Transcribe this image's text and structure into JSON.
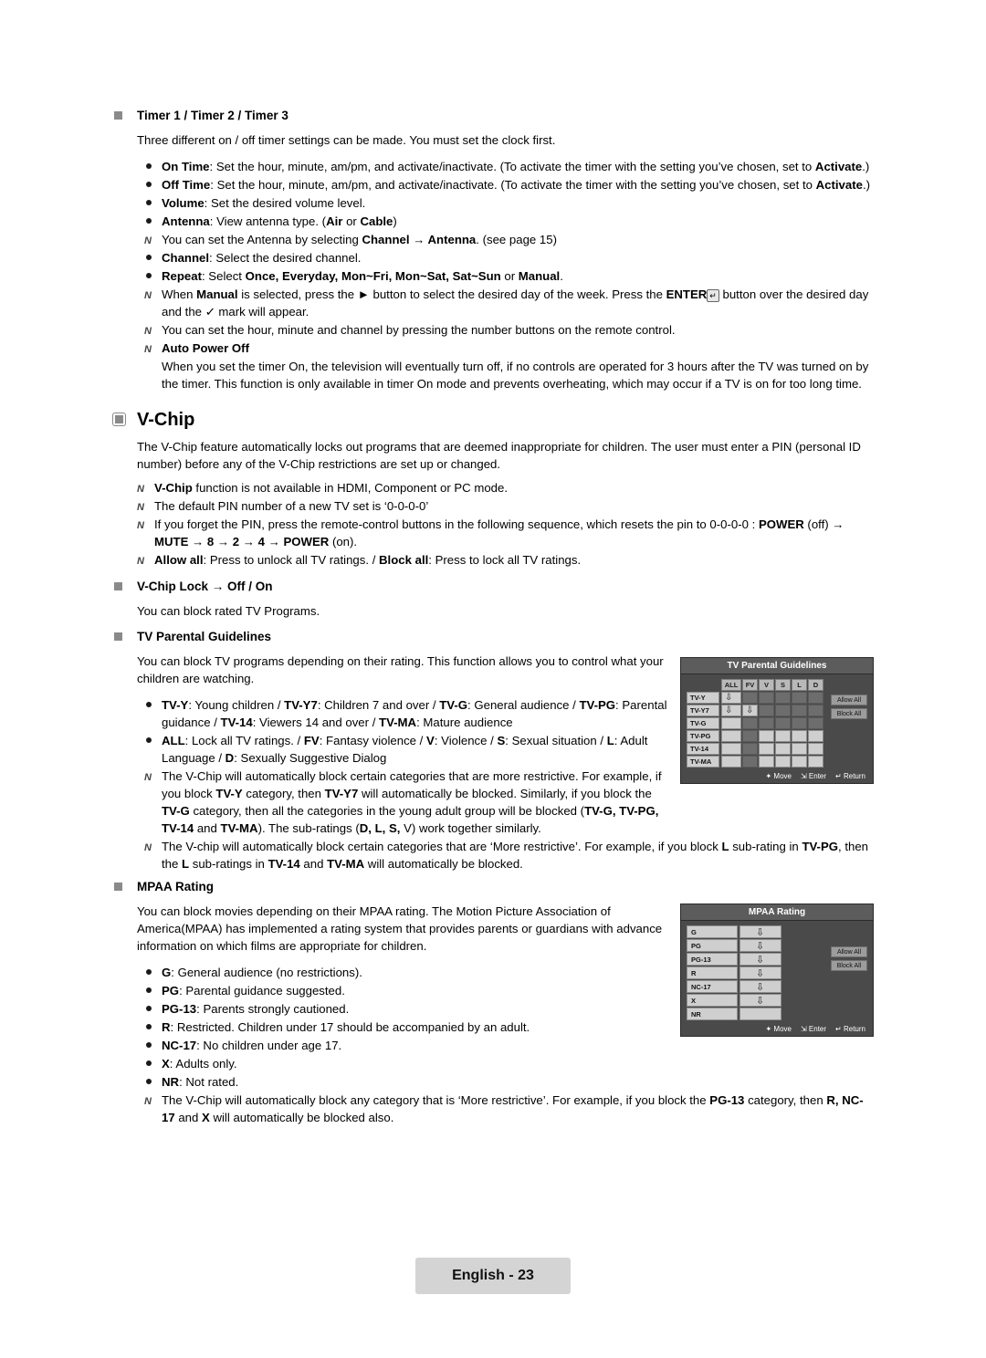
{
  "document": {
    "page_label": "English - 23"
  },
  "timer_section": {
    "heading": "Timer 1 / Timer 2 / Timer 3",
    "intro": "Three different on / off timer settings can be made. You must set the clock first.",
    "bullets": [
      {
        "label": "On Time",
        "text": ": Set the hour, minute, am/pm, and activate/inactivate. (To activate the timer with the setting you’ve chosen, set to Activate.)"
      },
      {
        "label": "Off Time",
        "text": ": Set the hour, minute, am/pm, and activate/inactivate. (To activate the timer with the setting you’ve chosen, set to Activate.)"
      },
      {
        "label": "Volume",
        "text": ": Set the desired volume level."
      },
      {
        "label": "Antenna",
        "text": ": View antenna type. (Air or Cable)"
      },
      {
        "label": "Channel",
        "text": ": Select the desired channel."
      },
      {
        "label": "Repeat",
        "text": ": Select Once, Everyday, Mon~Fri, Mon~Sat, Sat~Sun or Manual."
      }
    ],
    "note_antenna": "You can set the Antenna by selecting Channel → Antenna. (see page 15)",
    "note_manual": "When Manual is selected, press the ► button to select the desired day of the week. Press the ENTER button over the desired day and the ✓ mark will appear.",
    "note_numbers": "You can set the hour, minute and channel by pressing the number buttons on the remote control.",
    "auto_power_off": {
      "heading": "Auto Power Off",
      "text": "When you set the timer On, the television will eventually turn off, if no controls are operated for 3 hours after the TV was turned on by the timer. This function is only available in timer On mode and prevents overheating, which may occur if a TV is on for too long time."
    }
  },
  "vchip": {
    "title": "V-Chip",
    "intro": "The V-Chip feature automatically locks out programs that are deemed inappropriate for children. The user must enter a PIN (personal ID number) before any of the V-Chip restrictions are set up or changed.",
    "notes": [
      "V-Chip function is not available in HDMI, Component or PC mode.",
      "The default PIN number of a new TV set is ‘0-0-0-0’",
      "If you forget the PIN, press the remote-control buttons in the following sequence, which resets the pin to 0-0-0-0 : POWER (off) → MUTE → 8 → 2 → 4 → POWER (on).",
      "Allow all: Press to unlock all TV ratings. / Block all: Press to lock all TV ratings."
    ],
    "lock_heading": "V-Chip Lock → Off / On",
    "lock_text": "You can block rated TV Programs."
  },
  "tv_parental": {
    "heading": "TV Parental Guidelines",
    "intro": "You can block TV programs depending on their rating. This function allows you to control what your children are watching.",
    "bullets": [
      "TV-Y: Young children / TV-Y7: Children 7 and over / TV-G: General audience / TV-PG: Parental guidance / TV-14: Viewers 14 and over / TV-MA: Mature audience",
      "ALL: Lock all TV ratings. / FV: Fantasy violence / V: Violence / S: Sexual situation / L: Adult Language / D: Sexually Suggestive Dialog"
    ],
    "notes": [
      "The V-Chip will automatically block certain categories that are more restrictive. For example, if you block TV-Y category, then TV-Y7 will automatically be blocked. Similarly, if you block the TV-G category, then all the categories in the young adult group will be blocked (TV-G, TV-PG, TV-14 and TV-MA). The sub-ratings (D, L, S, V) work together similarly.",
      "The V-chip will automatically block certain categories that are ‘More restrictive’. For example, if you block L sub-rating in TV-PG, then the L sub-ratings in TV-14 and TV-MA will automatically be blocked."
    ],
    "osd": {
      "title": "TV Parental Guidelines",
      "columns": [
        "ALL",
        "FV",
        "V",
        "S",
        "L",
        "D"
      ],
      "rows": [
        {
          "label": "TV-Y",
          "locks": [
            true,
            false,
            false,
            false,
            false,
            false
          ],
          "disabled": [
            false,
            true,
            true,
            true,
            true,
            true
          ]
        },
        {
          "label": "TV-Y7",
          "locks": [
            true,
            true,
            false,
            false,
            false,
            false
          ],
          "disabled": [
            false,
            false,
            true,
            true,
            true,
            true
          ]
        },
        {
          "label": "TV-G",
          "locks": [
            false,
            false,
            false,
            false,
            false,
            false
          ],
          "disabled": [
            false,
            true,
            true,
            true,
            true,
            true
          ]
        },
        {
          "label": "TV-PG",
          "locks": [
            false,
            false,
            false,
            false,
            false,
            false
          ],
          "disabled": [
            false,
            true,
            false,
            false,
            false,
            false
          ]
        },
        {
          "label": "TV-14",
          "locks": [
            false,
            false,
            false,
            false,
            false,
            false
          ],
          "disabled": [
            false,
            true,
            false,
            false,
            false,
            false
          ]
        },
        {
          "label": "TV-MA",
          "locks": [
            false,
            false,
            false,
            false,
            false,
            false
          ],
          "disabled": [
            false,
            true,
            false,
            false,
            false,
            false
          ]
        }
      ],
      "buttons": [
        "Allow All",
        "Block All"
      ],
      "footer": [
        "Move",
        "Enter",
        "Return"
      ]
    }
  },
  "mpaa": {
    "heading": "MPAA Rating",
    "intro": "You can block movies depending on their MPAA rating. The Motion Picture Association of America(MPAA) has implemented a rating system that provides parents or guardians with advance information on which films are appropriate for children.",
    "bullets": [
      "G: General audience (no restrictions).",
      "PG: Parental guidance suggested.",
      "PG-13: Parents strongly cautioned.",
      "R: Restricted. Children under 17 should be accompanied by an adult.",
      "NC-17: No children under age 17.",
      "X: Adults only.",
      "NR: Not rated."
    ],
    "note": "The V-Chip will automatically block any category that is ‘More restrictive’. For example, if you block the PG-13 category, then R, NC-17 and X will automatically be blocked also.",
    "osd": {
      "title": "MPAA Rating",
      "rows": [
        {
          "label": "G",
          "locked": true
        },
        {
          "label": "PG",
          "locked": true
        },
        {
          "label": "PG-13",
          "locked": true
        },
        {
          "label": "R",
          "locked": true
        },
        {
          "label": "NC-17",
          "locked": true
        },
        {
          "label": "X",
          "locked": true
        },
        {
          "label": "NR",
          "locked": false
        }
      ],
      "buttons": [
        "Allow All",
        "Block All"
      ],
      "footer": [
        "Move",
        "Enter",
        "Return"
      ]
    }
  }
}
